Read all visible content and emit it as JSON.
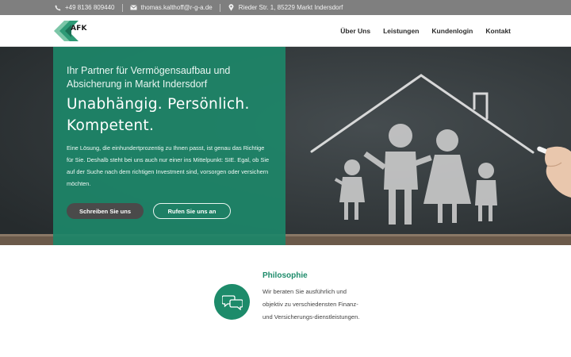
{
  "topbar": {
    "phone_icon": "phone-icon",
    "phone": "+49 8136 809440",
    "mail_icon": "envelope-icon",
    "email": "thomas.kalthoff@r-g-a.de",
    "location_icon": "map-pin-icon",
    "address": "Rieder Str. 1, 85229 Markt Indersdorf"
  },
  "header": {
    "logo_text": "AFK",
    "nav": [
      {
        "label": "Über Uns"
      },
      {
        "label": "Leistungen"
      },
      {
        "label": "Kundenlogin"
      },
      {
        "label": "Kontakt"
      }
    ]
  },
  "hero": {
    "lead": "Ihr Partner für Vermögensaufbau und Absicherung in Markt Indersdorf",
    "headline": "Unabhängig. Persönlich. Kompetent.",
    "body": "Eine Lösung, die einhundertprozentig zu Ihnen passt, ist genau das Richtige für Sie. Deshalb steht bei uns auch nur einer ins Mittelpunkt: SIE. Egal, ob Sie auf der Suche nach dem richtigen Investment sind, vorsorgen oder versichern möchten.",
    "button_write": "Schreiben Sie uns",
    "button_call": "Rufen Sie uns an"
  },
  "philosophy": {
    "icon": "speech-bubbles-icon",
    "title": "Philosophie",
    "text": "Wir beraten Sie ausführlich und objektiv zu verschiedensten Finanz- und Versicherungs-dienstleistungen."
  },
  "colors": {
    "accent": "#1d8b6a",
    "topbar": "#7f7f7f",
    "chalkboard": "#2f3538"
  }
}
